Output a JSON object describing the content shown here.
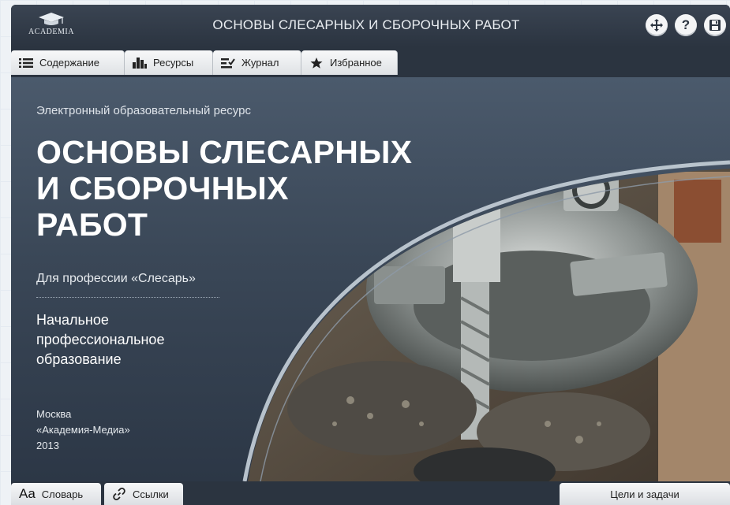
{
  "app": {
    "logo_text": "ACADEMIA",
    "title": "ОСНОВЫ СЛЕСАРНЫХ И СБОРОЧНЫХ РАБОТ"
  },
  "toolbar": {
    "fullscreen_icon": "fullscreen-icon",
    "help_label": "?",
    "save_icon": "floppy-disk-icon"
  },
  "tabs": [
    {
      "label": "Содержание",
      "icon": "list-icon"
    },
    {
      "label": "Ресурсы",
      "icon": "bar-chart-icon"
    },
    {
      "label": "Журнал",
      "icon": "checklist-icon"
    },
    {
      "label": "Избранное",
      "icon": "star-icon"
    }
  ],
  "cover": {
    "subtitle": "Электронный образовательный ресурс",
    "title_lines": [
      "ОСНОВЫ СЛЕСАРНЫХ",
      "И СБОРОЧНЫХ",
      "РАБОТ"
    ],
    "profession": "Для профессии «Слесарь»",
    "level_lines": [
      "Начальное",
      "профессиональное",
      "образование"
    ],
    "imprint": [
      "Москва",
      "«Академия-Медиа»",
      "2013"
    ]
  },
  "footer": {
    "glossary_prefix": "Aa",
    "glossary_label": "Словарь",
    "links_label": "Ссылки",
    "goals_label": "Цели и задачи"
  },
  "colors": {
    "window_bg": "#2b3440",
    "accent_curve": "#c7d0d9",
    "tab_bg": "#eceef0"
  }
}
